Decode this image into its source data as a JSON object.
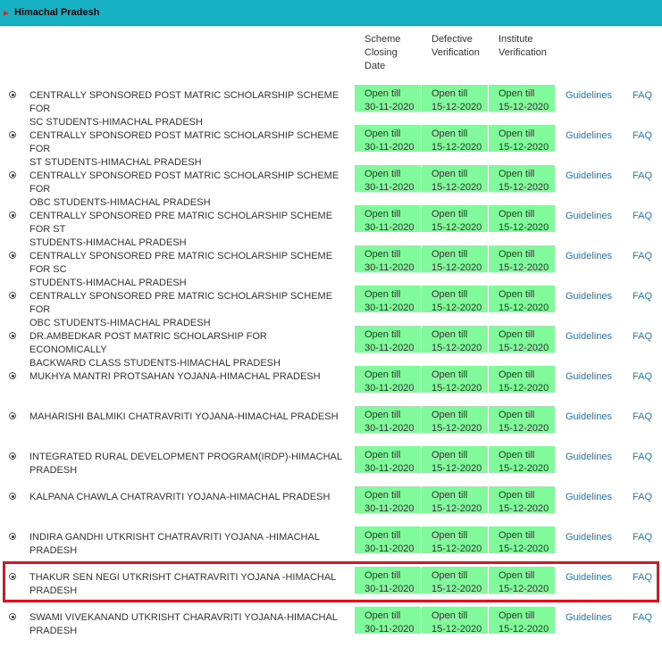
{
  "state": {
    "name": "Himachal Pradesh",
    "icon": "caret-right-icon"
  },
  "headers": {
    "closing": [
      "Scheme",
      "Closing",
      "Date"
    ],
    "defective": [
      "Defective",
      "Verification"
    ],
    "institute": [
      "Institute",
      "Verification"
    ]
  },
  "rows": [
    {
      "scheme": [
        "CENTRALLY SPONSORED POST MATRIC SCHOLARSHIP SCHEME FOR",
        "SC STUDENTS-HIMACHAL PRADESH"
      ],
      "closing": [
        "Open till",
        "30-11-2020"
      ],
      "defective": [
        "Open till",
        "15-12-2020"
      ],
      "institute": [
        "Open till",
        "15-12-2020"
      ],
      "guidelines": "Guidelines",
      "faq": "FAQ"
    },
    {
      "scheme": [
        "CENTRALLY SPONSORED POST MATRIC SCHOLARSHIP SCHEME FOR",
        "ST STUDENTS-HIMACHAL PRADESH"
      ],
      "closing": [
        "Open till",
        "30-11-2020"
      ],
      "defective": [
        "Open till",
        "15-12-2020"
      ],
      "institute": [
        "Open till",
        "15-12-2020"
      ],
      "guidelines": "Guidelines",
      "faq": "FAQ"
    },
    {
      "scheme": [
        "CENTRALLY SPONSORED POST MATRIC SCHOLARSHIP SCHEME FOR",
        "OBC STUDENTS-HIMACHAL PRADESH"
      ],
      "closing": [
        "Open till",
        "30-11-2020"
      ],
      "defective": [
        "Open till",
        "15-12-2020"
      ],
      "institute": [
        "Open till",
        "15-12-2020"
      ],
      "guidelines": "Guidelines",
      "faq": "FAQ"
    },
    {
      "scheme": [
        "CENTRALLY SPONSORED PRE MATRIC SCHOLARSHIP SCHEME FOR ST",
        "STUDENTS-HIMACHAL PRADESH"
      ],
      "closing": [
        "Open till",
        "30-11-2020"
      ],
      "defective": [
        "Open till",
        "15-12-2020"
      ],
      "institute": [
        "Open till",
        "15-12-2020"
      ],
      "guidelines": "Guidelines",
      "faq": "FAQ"
    },
    {
      "scheme": [
        "CENTRALLY SPONSORED PRE MATRIC SCHOLARSHIP SCHEME FOR SC",
        "STUDENTS-HIMACHAL PRADESH"
      ],
      "closing": [
        "Open till",
        "30-11-2020"
      ],
      "defective": [
        "Open till",
        "15-12-2020"
      ],
      "institute": [
        "Open till",
        "15-12-2020"
      ],
      "guidelines": "Guidelines",
      "faq": "FAQ"
    },
    {
      "scheme": [
        "CENTRALLY SPONSORED PRE MATRIC SCHOLARSHIP SCHEME FOR",
        "OBC STUDENTS-HIMACHAL PRADESH"
      ],
      "closing": [
        "Open till",
        "30-11-2020"
      ],
      "defective": [
        "Open till",
        "15-12-2020"
      ],
      "institute": [
        "Open till",
        "15-12-2020"
      ],
      "guidelines": "Guidelines",
      "faq": "FAQ"
    },
    {
      "scheme": [
        "DR.AMBEDKAR POST MATRIC SCHOLARSHIP FOR ECONOMICALLY",
        "BACKWARD CLASS STUDENTS-HIMACHAL PRADESH"
      ],
      "closing": [
        "Open till",
        "30-11-2020"
      ],
      "defective": [
        "Open till",
        "15-12-2020"
      ],
      "institute": [
        "Open till",
        "15-12-2020"
      ],
      "guidelines": "Guidelines",
      "faq": "FAQ"
    },
    {
      "scheme": [
        "MUKHYA MANTRI PROTSAHAN YOJANA-HIMACHAL PRADESH",
        ""
      ],
      "closing": [
        "Open till",
        "30-11-2020"
      ],
      "defective": [
        "Open till",
        "15-12-2020"
      ],
      "institute": [
        "Open till",
        "15-12-2020"
      ],
      "guidelines": "Guidelines",
      "faq": "FAQ"
    },
    {
      "scheme": [
        "MAHARISHI BALMIKI CHATRAVRITI YOJANA-HIMACHAL PRADESH",
        ""
      ],
      "closing": [
        "Open till",
        "30-11-2020"
      ],
      "defective": [
        "Open till",
        "15-12-2020"
      ],
      "institute": [
        "Open till",
        "15-12-2020"
      ],
      "guidelines": "Guidelines",
      "faq": "FAQ"
    },
    {
      "scheme": [
        "INTEGRATED RURAL DEVELOPMENT PROGRAM(IRDP)-HIMACHAL",
        "PRADESH"
      ],
      "closing": [
        "Open till",
        "30-11-2020"
      ],
      "defective": [
        "Open till",
        "15-12-2020"
      ],
      "institute": [
        "Open till",
        "15-12-2020"
      ],
      "guidelines": "Guidelines",
      "faq": "FAQ"
    },
    {
      "scheme": [
        "KALPANA CHAWLA CHATRAVRITI YOJANA-HIMACHAL PRADESH",
        ""
      ],
      "closing": [
        "Open till",
        "30-11-2020"
      ],
      "defective": [
        "Open till",
        "15-12-2020"
      ],
      "institute": [
        "Open till",
        "15-12-2020"
      ],
      "guidelines": "Guidelines",
      "faq": "FAQ"
    },
    {
      "scheme": [
        "INDIRA GANDHI UTKRISHT CHATRAVRITI YOJANA -HIMACHAL",
        "PRADESH"
      ],
      "closing": [
        "Open till",
        "30-11-2020"
      ],
      "defective": [
        "Open till",
        "15-12-2020"
      ],
      "institute": [
        "Open till",
        "15-12-2020"
      ],
      "guidelines": "Guidelines",
      "faq": "FAQ"
    },
    {
      "scheme": [
        "THAKUR SEN NEGI UTKRISHT CHATRAVRITI YOJANA -HIMACHAL",
        "PRADESH"
      ],
      "closing": [
        "Open till",
        "30-11-2020"
      ],
      "defective": [
        "Open till",
        "15-12-2020"
      ],
      "institute": [
        "Open till",
        "15-12-2020"
      ],
      "guidelines": "Guidelines",
      "faq": "FAQ",
      "highlighted": true
    },
    {
      "scheme": [
        "SWAMI VIVEKANAND UTKRISHT CHARAVRITI YOJANA-HIMACHAL",
        "PRADESH"
      ],
      "closing": [
        "Open till",
        "30-11-2020"
      ],
      "defective": [
        "Open till",
        "15-12-2020"
      ],
      "institute": [
        "Open till",
        "15-12-2020"
      ],
      "guidelines": "Guidelines",
      "faq": "FAQ"
    }
  ],
  "colors": {
    "header_bar": "#17b1c4",
    "pill": "#80fa9a",
    "link": "#2a74b8",
    "highlight": "#e0121f"
  }
}
